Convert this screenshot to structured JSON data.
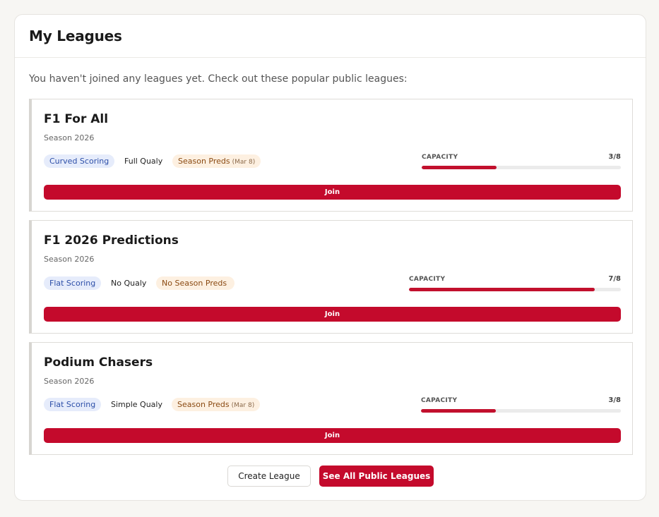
{
  "header": {
    "title": "My Leagues"
  },
  "intro": "You haven't joined any leagues yet. Check out these popular public leagues:",
  "leagues": [
    {
      "name": "F1 For All",
      "season": "Season 2026",
      "scoring": "Curved Scoring",
      "qualy": "Full Qualy",
      "preds": "Season Preds",
      "preds_date": "(Mar 8)",
      "capacity_label": "CAPACITY",
      "capacity": "3/8",
      "capacity_fraction": 0.375,
      "join_label": "Join"
    },
    {
      "name": "F1 2026 Predictions",
      "season": "Season 2026",
      "scoring": "Flat Scoring",
      "qualy": "No Qualy",
      "preds": "No Season Preds",
      "preds_date": "",
      "capacity_label": "CAPACITY",
      "capacity": "7/8",
      "capacity_fraction": 0.875,
      "join_label": "Join"
    },
    {
      "name": "Podium Chasers",
      "season": "Season 2026",
      "scoring": "Flat Scoring",
      "qualy": "Simple Qualy",
      "preds": "Season Preds",
      "preds_date": "(Mar 8)",
      "capacity_label": "CAPACITY",
      "capacity": "3/8",
      "capacity_fraction": 0.375,
      "join_label": "Join"
    }
  ],
  "footer": {
    "create_label": "Create League",
    "see_all_label": "See All Public Leagues"
  },
  "colors": {
    "accent": "#c40a2c",
    "scoring_tag_bg": "#e6ecfb",
    "preds_tag_bg": "#fdf0e1"
  }
}
